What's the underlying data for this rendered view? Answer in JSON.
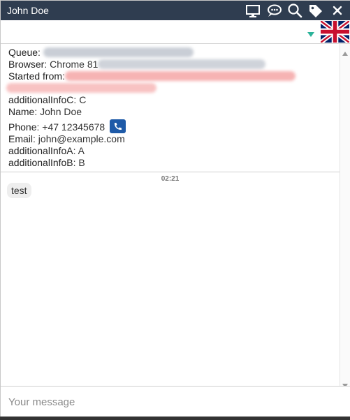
{
  "window": {
    "title": "John Doe"
  },
  "toolbar": {
    "icons": [
      "monitor-icon",
      "chat-bubble-icon",
      "search-icon",
      "tag-icon",
      "close-icon"
    ],
    "language_flag": "uk-flag-icon",
    "accent_color": "#2bb39a"
  },
  "info": {
    "queue_label": "Queue",
    "browser_label": "Browser",
    "browser_value": "Chrome 81",
    "started_from_label": "Started from",
    "additionalInfoC_label": "additionalInfoC",
    "additionalInfoC_value": "C",
    "name_label": "Name",
    "name_value": "John Doe",
    "phone_label": "Phone",
    "phone_value": "+47 12345678",
    "email_label": "Email",
    "email_value": "john@example.com",
    "additionalInfoA_label": "additionalInfoA",
    "additionalInfoA_value": "A",
    "additionalInfoB_label": "additionalInfoB",
    "additionalInfoB_value": "B"
  },
  "chat": {
    "messages": [
      {
        "time": "02:21",
        "text": "test"
      }
    ]
  },
  "composer": {
    "placeholder": "Your message"
  },
  "colors": {
    "titlebar": "#2f3d50",
    "phone_button": "#1e5aa8"
  }
}
